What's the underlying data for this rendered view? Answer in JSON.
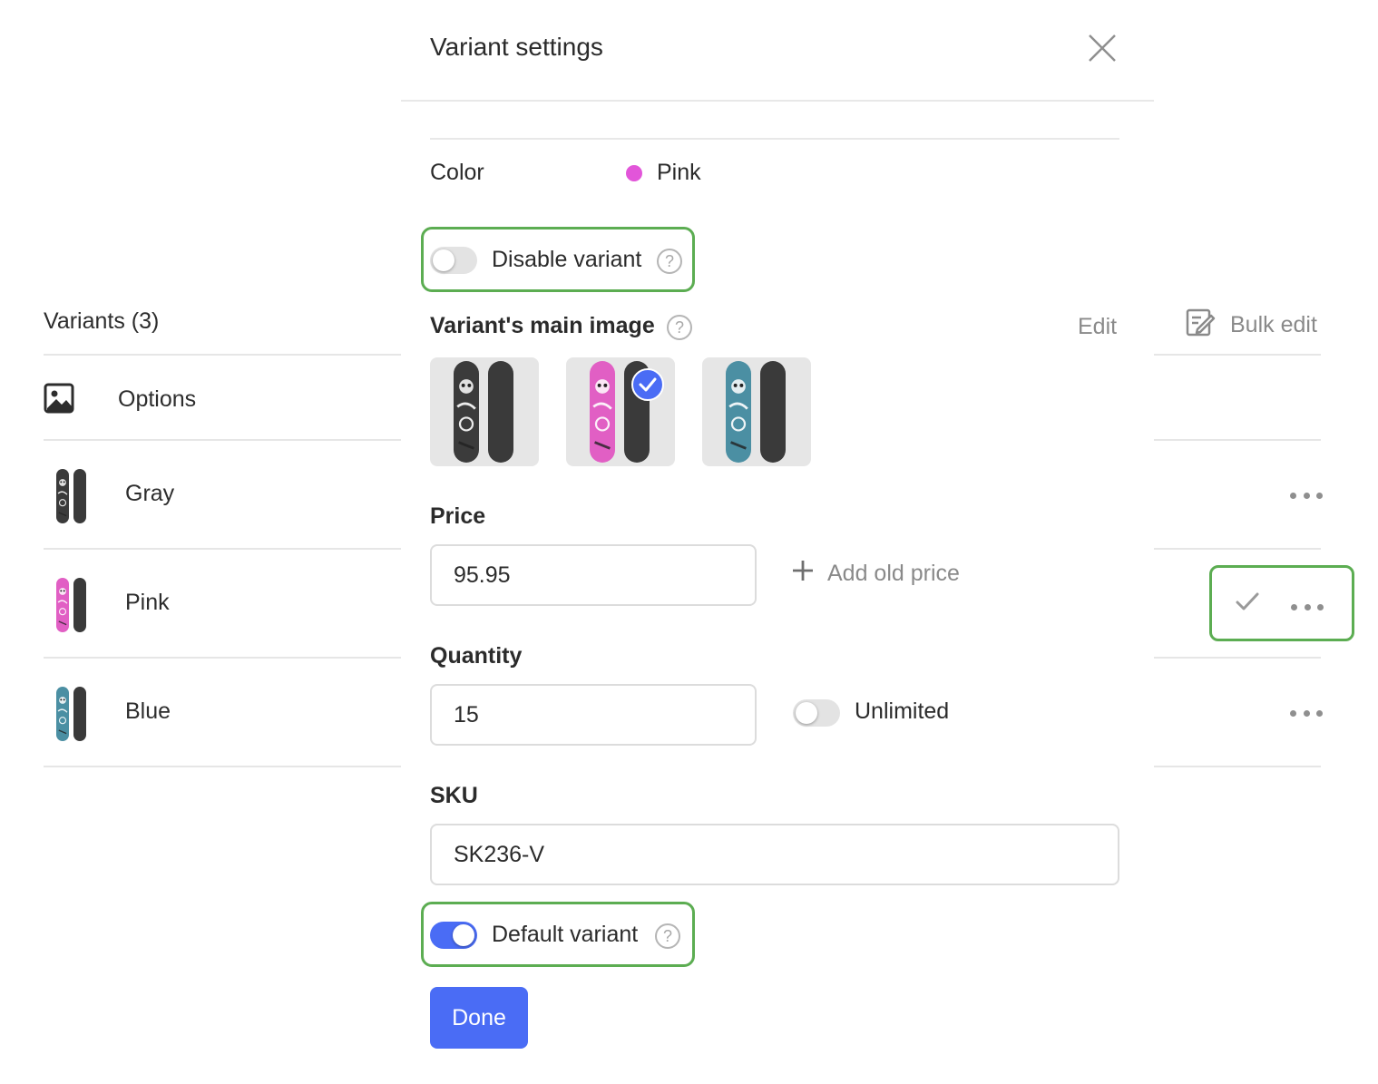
{
  "background": {
    "variants_title": "Variants (3)",
    "options_label": "Options",
    "bulk_edit_label": "Bulk edit",
    "variants": [
      {
        "label": "Gray",
        "deck_color": "#3b3b3b"
      },
      {
        "label": "Pink",
        "deck_color": "#e15fc4"
      },
      {
        "label": "Blue",
        "deck_color": "#4b8fa3"
      }
    ]
  },
  "modal": {
    "title": "Variant settings",
    "color_label": "Color",
    "color_value": "Pink",
    "color_swatch": "#e255d9",
    "disable_variant_label": "Disable variant",
    "disable_variant_on": false,
    "help_glyph": "?",
    "main_image_label": "Variant's main image",
    "edit_label": "Edit",
    "images": [
      {
        "deck_color": "#3b3b3b",
        "selected": false
      },
      {
        "deck_color": "#e15fc4",
        "selected": true
      },
      {
        "deck_color": "#4b8fa3",
        "selected": false
      }
    ],
    "price_label": "Price",
    "price_value": "95.95",
    "add_old_price_label": "Add old price",
    "quantity_label": "Quantity",
    "quantity_value": "15",
    "unlimited_label": "Unlimited",
    "unlimited_on": false,
    "sku_label": "SKU",
    "sku_value": "SK236-V",
    "default_variant_label": "Default variant",
    "default_variant_on": true,
    "done_label": "Done"
  },
  "colors": {
    "accent": "#4a6cf5",
    "highlight_border": "#5cad52",
    "divider": "#e6e6e6",
    "muted_text": "#8a8a8a"
  }
}
